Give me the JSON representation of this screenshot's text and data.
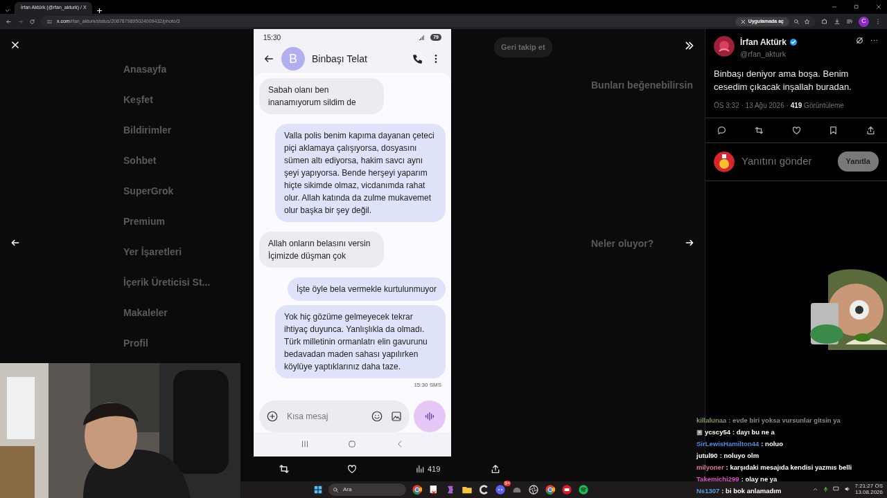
{
  "browser": {
    "tab_title": "İrfan Aktürk (@rfan_akturk) / X",
    "url_host": "x.com",
    "url_path": "/rfan_akturk/status/2087879895024009432/photo/3",
    "open_in_app": "Uygulamada aç",
    "profile_initial": "C"
  },
  "background_nav": {
    "items": [
      "Anasayfa",
      "Keşfet",
      "Bildirimler",
      "Sohbet",
      "SuperGrok",
      "Premium",
      "Yer İşaretleri",
      "İçerik Üreticisi St...",
      "Makaleler",
      "Profil"
    ]
  },
  "background_side": {
    "follow_button": "Geri takip et",
    "headings": [
      "Bunları beğenebilirsin",
      "Neler oluyor?"
    ]
  },
  "phone": {
    "time": "15:30",
    "battery": "79",
    "contact": "Binbaşı Telat",
    "avatar_letter": "B",
    "messages": [
      {
        "kind": "incoming",
        "text": "Sabah olanı ben inanamıyorum sildim de"
      },
      {
        "kind": "outgoing",
        "text": "Valla polis benim kapıma dayanan çeteci piçi aklamaya çalışıyorsa, dosyasını sümen altı ediyorsa,  hakim savcı aynı şeyi yapıyorsa. Bende herşeyi yaparım hiçte sikimde olmaz, vicdanımda rahat olur. Allah katında da zulme mukavemet olur başka bir şey değil."
      },
      {
        "kind": "incoming",
        "text": "Allah onların belasını versin İçimizde düşman çok"
      },
      {
        "kind": "outgoing",
        "text": "İşte öyle bela vermekle kurtulunmuyor"
      },
      {
        "kind": "outgoing",
        "text": "Yok hiç gözüme gelmeyecek tekrar ihtiyaç duyunca. Yanlışlıkla da olmadı. Türk milletinin ormanlatrı elin gavurunu bedavadan maden sahası yapılırken köylüye yaptıklarınız daha taze."
      }
    ],
    "meta": "15:30 SMS",
    "composer_placeholder": "Kısa mesaj"
  },
  "photo_actions": {
    "views": "419"
  },
  "tweet": {
    "author": "İrfan Aktürk",
    "verified": true,
    "handle": "@rfan_akturk",
    "text": "Binbaşı deniyor ama boşa. Benim cesedim çıkacak inşallah buradan.",
    "meta": "ÖS 3:32 · 13 Ağu 2026 · ",
    "views": "419",
    "views_label": "Görüntüleme",
    "reply_placeholder": "Yanıtını gönder",
    "reply_button": "Yanıtla"
  },
  "chat": {
    "messages": [
      {
        "user": "killalunaa",
        "color": "#7d9a6c",
        "text": ": evde biri yoksa vursunlar gitsin ya",
        "badge": false
      },
      {
        "user": "ycscy54",
        "color": "#ffffff",
        "text": ": dayı bu ne a",
        "badge": true
      },
      {
        "user": "SirLewisHamilton44",
        "color": "#4f8de0",
        "text": ": noluo",
        "badge": false
      },
      {
        "user": "jutul90",
        "color": "#ffffff",
        "text": ": noluyo olm",
        "badge": false
      },
      {
        "user": "milyoner",
        "color": "#e07896",
        "text": ": karşıdaki mesajıda kendisi yazmıs belli",
        "badge": false
      },
      {
        "user": "Takemichi299",
        "color": "#e050c8",
        "text": ": olay ne ya",
        "badge": false
      },
      {
        "user": "Ns1307",
        "color": "#5a9ee8",
        "text": ": bi bok anlamadım",
        "badge": false
      }
    ]
  },
  "taskbar": {
    "search_placeholder": "Ara",
    "apps": [
      {
        "kind": "chrome"
      },
      {
        "kind": "snip"
      },
      {
        "kind": "copilot"
      },
      {
        "kind": "folder"
      },
      {
        "kind": "ccleaner"
      },
      {
        "kind": "discord",
        "badge": "9+"
      },
      {
        "kind": "helmet"
      },
      {
        "kind": "aperture"
      },
      {
        "kind": "chrome"
      },
      {
        "kind": "red"
      },
      {
        "kind": "spotify"
      }
    ],
    "time": "7:21:27 ÖS",
    "date": "13.08.2026"
  }
}
